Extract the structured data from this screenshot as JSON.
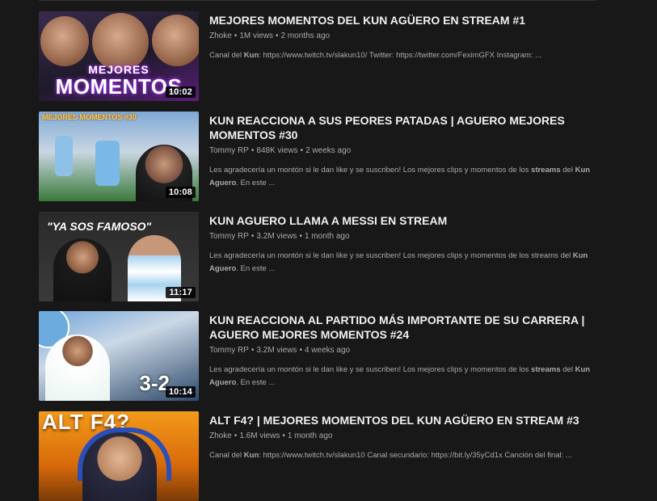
{
  "results": [
    {
      "title": "MEJORES MOMENTOS DEL KUN AGÜERO EN STREAM #1",
      "channel": "Zhoke",
      "views": "1M views",
      "age": "2 months ago",
      "desc_bold": "Kun",
      "desc_pre": "Canal del ",
      "desc_post": ": https://www.twitch.tv/slakun10/ Twitter: https://twitter.com/FeximGFX Instagram: ...",
      "duration": "10:02",
      "thumb_text": [
        "MEJORES",
        "MOMENTOS"
      ]
    },
    {
      "title": "KUN REACCIONA A SUS PEORES PATADAS | AGUERO MEJORES MOMENTOS #30",
      "channel": "Tommy RP",
      "views": "848K views",
      "age": "2 weeks ago",
      "desc_pre": "Les agradecería un montón si le dan like y se suscriben! Los mejores clips y momentos de los ",
      "desc_bold": "streams",
      "desc_mid": " del ",
      "desc_bold2": "Kun Aguero",
      "desc_post": ". En este ...",
      "duration": "10:08",
      "thumb_text": [
        "MEJORES MOMENTOS #30"
      ]
    },
    {
      "title": "KUN AGUERO LLAMA A MESSI EN STREAM",
      "channel": "Tommy RP",
      "views": "3.2M views",
      "age": "1 month ago",
      "desc_pre": "Les agradecería un montón si le dan like y se suscriben! Los mejores clips y momentos de los streams del ",
      "desc_bold": "Kun Aguero",
      "desc_post": ". En este ...",
      "duration": "11:17",
      "thumb_text": [
        "\"YA SOS FAMOSO\""
      ]
    },
    {
      "title": "KUN REACCIONA AL PARTIDO MÁS IMPORTANTE DE SU CARRERA | AGUERO MEJORES MOMENTOS #24",
      "channel": "Tommy RP",
      "views": "3.2M views",
      "age": "4 weeks ago",
      "desc_pre": "Les agradecería un montón si le dan like y se suscriben! Los mejores clips y momentos de los ",
      "desc_bold": "streams",
      "desc_mid": " del ",
      "desc_bold2": "Kun Aguero",
      "desc_post": ". En este ...",
      "duration": "10:14",
      "thumb_text": [
        "3-2"
      ]
    },
    {
      "title": "ALT F4? | MEJORES MOMENTOS DEL KUN AGÜERO EN STREAM #3",
      "channel": "Zhoke",
      "views": "1.6M views",
      "age": "1 month ago",
      "desc_pre": "Canal del ",
      "desc_bold": "Kun",
      "desc_post": ": https://www.twitch.tv/slakun10 Canal secundario: https://bit.ly/35yCd1x Canción del final: ...",
      "duration": "",
      "thumb_text": [
        "ALT F4?"
      ]
    }
  ],
  "meta_separator": "•"
}
